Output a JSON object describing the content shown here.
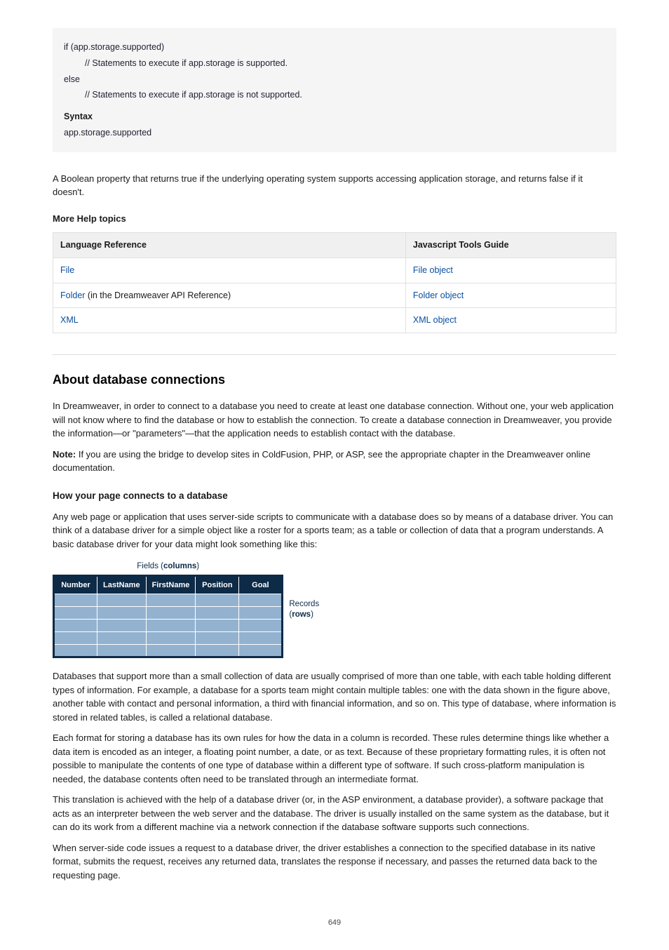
{
  "code_box": {
    "line1": "if (app.storage.supported)",
    "line2_indent": "// Statements to execute if app.storage is supported.",
    "line3": "else",
    "line4_indent": "// Statements to execute if app.storage is not supported.",
    "syntax_label": "Syntax",
    "syntax_line": "app.storage.supported"
  },
  "para1": "A Boolean property that returns true if the underlying operating system supports accessing application storage, and returns false if it doesn't.",
  "more_help_label": "More Help topics",
  "ref_header_left": "Language Reference",
  "ref_header_right": "Javascript Tools Guide",
  "rows": [
    {
      "left": "File",
      "right": "File object"
    },
    {
      "left": "Folder",
      "note": " (in the Dreamweaver API Reference)",
      "right": "Folder object"
    },
    {
      "left": "XML",
      "right": "XML object"
    }
  ],
  "topic_title": "About database connections",
  "p_intro": "In Dreamweaver, in order to connect to a database you need to create at least one database connection. Without one, your web application will not know where to find the database or how to establish the connection. To create a database connection in Dreamweaver, you provide the information—or \"parameters\"—that the application needs to establish contact with the database.",
  "note_label": "Note:",
  "note_text": "If you are using the bridge to develop sites in ColdFusion, PHP, or ASP, see the appropriate chapter in the Dreamweaver online documentation.",
  "sub1": "How your page connects to a database",
  "p_conn": "Any web page or application that uses server-side scripts to communicate with a database does so by means of a database driver. You can think of a database driver for a simple object like a roster for a sports team; as a table or collection of data that a program understands. A basic database driver for your data might look something like this:",
  "fig": {
    "top_label_prefix": "Fields (",
    "top_label_bold": "columns",
    "top_label_suffix": ")",
    "headers": [
      "Number",
      "LastName",
      "FirstName",
      "Position",
      "Goal"
    ],
    "side_prefix": "Records",
    "side_paren_open": "(",
    "side_bold": "rows",
    "side_paren_close": ")"
  },
  "p_after_fig1": "Databases that support more than a small collection of data are usually comprised of more than one table, with each table holding different types of information. For example, a database for a sports team might contain multiple tables: one with the data shown in the figure above, another table with contact and personal information, a third with financial information, and so on. This type of database, where information is stored in related tables, is called a relational database.",
  "p_after_fig2": "Each format for storing a database has its own rules for how the data in a column is recorded. These rules determine things like whether a data item is encoded as an integer, a floating point number, a date, or as text. Because of these proprietary formatting rules, it is often not possible to manipulate the contents of one type of database within a different type of software. If such cross-platform manipulation is needed, the database contents often need to be translated through an intermediate format.",
  "p_after_fig3": "This translation is achieved with the help of a database driver (or, in the ASP environment, a database provider), a software package that acts as an interpreter between the web server and the database. The driver is usually installed on the same system as the database, but it can do its work from a different machine via a network connection if the database software supports such connections.",
  "p_after_fig4": "When server-side code issues a request to a database driver, the driver establishes a connection to the specified database in its native format, submits the request, receives any returned data, translates the response if necessary, and passes the returned data back to the requesting page.",
  "page_number": "649"
}
